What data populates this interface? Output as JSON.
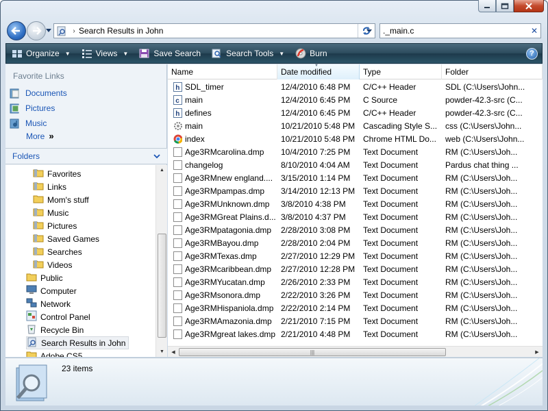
{
  "window": {
    "address_path": "Search Results in John"
  },
  "search": {
    "value": "._main.c"
  },
  "toolbar": {
    "organize": "Organize",
    "views": "Views",
    "save_search": "Save Search",
    "search_tools": "Search Tools",
    "burn": "Burn",
    "help": "?"
  },
  "favorites": {
    "title": "Favorite Links",
    "items": [
      "Documents",
      "Pictures",
      "Music"
    ],
    "more": "More"
  },
  "folders": {
    "title": "Folders",
    "items": [
      {
        "label": "Favorites",
        "icon": "favorites-folder-icon"
      },
      {
        "label": "Links",
        "icon": "links-folder-icon"
      },
      {
        "label": "Mom's stuff",
        "icon": "folder-icon"
      },
      {
        "label": "Music",
        "icon": "music-folder-icon"
      },
      {
        "label": "Pictures",
        "icon": "pictures-folder-icon"
      },
      {
        "label": "Saved Games",
        "icon": "saved-games-folder-icon"
      },
      {
        "label": "Searches",
        "icon": "searches-folder-icon"
      },
      {
        "label": "Videos",
        "icon": "videos-folder-icon"
      },
      {
        "label": "Public",
        "icon": "public-folder-icon"
      },
      {
        "label": "Computer",
        "icon": "computer-icon"
      },
      {
        "label": "Network",
        "icon": "network-icon"
      },
      {
        "label": "Control Panel",
        "icon": "control-panel-icon"
      },
      {
        "label": "Recycle Bin",
        "icon": "recycle-bin-icon"
      },
      {
        "label": "Search Results in John",
        "icon": "search-results-icon"
      },
      {
        "label": "Adobe CS5",
        "icon": "folder-icon"
      }
    ]
  },
  "columns": [
    "Name",
    "Date modified",
    "Type",
    "Folder"
  ],
  "files": [
    {
      "name": "SDL_timer",
      "date": "12/4/2010 6:48 PM",
      "type": "C/C++ Header",
      "folder": "SDL (C:\\Users\\John...",
      "icon": "h"
    },
    {
      "name": "main",
      "date": "12/4/2010 6:45 PM",
      "type": "C Source",
      "folder": "powder-42.3-src (C...",
      "icon": "c"
    },
    {
      "name": "defines",
      "date": "12/4/2010 6:45 PM",
      "type": "C/C++ Header",
      "folder": "powder-42.3-src (C...",
      "icon": "h"
    },
    {
      "name": "main",
      "date": "10/21/2010 5:48 PM",
      "type": "Cascading Style S...",
      "folder": "css (C:\\Users\\John...",
      "icon": "css"
    },
    {
      "name": "index",
      "date": "10/21/2010 5:48 PM",
      "type": "Chrome HTML Do...",
      "folder": "web (C:\\Users\\John...",
      "icon": "chrome"
    },
    {
      "name": "Age3RMcarolina.dmp",
      "date": "10/4/2010 7:25 PM",
      "type": "Text Document",
      "folder": "RM (C:\\Users\\Joh...",
      "icon": "txt"
    },
    {
      "name": "changelog",
      "date": "8/10/2010 4:04 AM",
      "type": "Text Document",
      "folder": "Pardus chat thing ...",
      "icon": "txt"
    },
    {
      "name": "Age3RMnew england....",
      "date": "3/15/2010 1:14 PM",
      "type": "Text Document",
      "folder": "RM (C:\\Users\\Joh...",
      "icon": "txt"
    },
    {
      "name": "Age3RMpampas.dmp",
      "date": "3/14/2010 12:13 PM",
      "type": "Text Document",
      "folder": "RM (C:\\Users\\Joh...",
      "icon": "txt"
    },
    {
      "name": "Age3RMUnknown.dmp",
      "date": "3/8/2010 4:38 PM",
      "type": "Text Document",
      "folder": "RM (C:\\Users\\Joh...",
      "icon": "txt"
    },
    {
      "name": "Age3RMGreat Plains.d...",
      "date": "3/8/2010 4:37 PM",
      "type": "Text Document",
      "folder": "RM (C:\\Users\\Joh...",
      "icon": "txt"
    },
    {
      "name": "Age3RMpatagonia.dmp",
      "date": "2/28/2010 3:08 PM",
      "type": "Text Document",
      "folder": "RM (C:\\Users\\Joh...",
      "icon": "txt"
    },
    {
      "name": "Age3RMBayou.dmp",
      "date": "2/28/2010 2:04 PM",
      "type": "Text Document",
      "folder": "RM (C:\\Users\\Joh...",
      "icon": "txt"
    },
    {
      "name": "Age3RMTexas.dmp",
      "date": "2/27/2010 12:29 PM",
      "type": "Text Document",
      "folder": "RM (C:\\Users\\Joh...",
      "icon": "txt"
    },
    {
      "name": "Age3RMcaribbean.dmp",
      "date": "2/27/2010 12:28 PM",
      "type": "Text Document",
      "folder": "RM (C:\\Users\\Joh...",
      "icon": "txt"
    },
    {
      "name": "Age3RMYucatan.dmp",
      "date": "2/26/2010 2:33 PM",
      "type": "Text Document",
      "folder": "RM (C:\\Users\\Joh...",
      "icon": "txt"
    },
    {
      "name": "Age3RMsonora.dmp",
      "date": "2/22/2010 3:26 PM",
      "type": "Text Document",
      "folder": "RM (C:\\Users\\Joh...",
      "icon": "txt"
    },
    {
      "name": "Age3RMHispaniola.dmp",
      "date": "2/22/2010 2:14 PM",
      "type": "Text Document",
      "folder": "RM (C:\\Users\\Joh...",
      "icon": "txt"
    },
    {
      "name": "Age3RMAmazonia.dmp",
      "date": "2/21/2010 7:15 PM",
      "type": "Text Document",
      "folder": "RM (C:\\Users\\Joh...",
      "icon": "txt"
    },
    {
      "name": "Age3RMgreat lakes.dmp",
      "date": "2/21/2010 4:48 PM",
      "type": "Text Document",
      "folder": "RM (C:\\Users\\Joh...",
      "icon": "txt"
    }
  ],
  "details": {
    "count": "23 items"
  },
  "colors": {
    "toolbar": "#2b4a5c",
    "link": "#1a55b5",
    "frame": "#d5e0ec"
  }
}
